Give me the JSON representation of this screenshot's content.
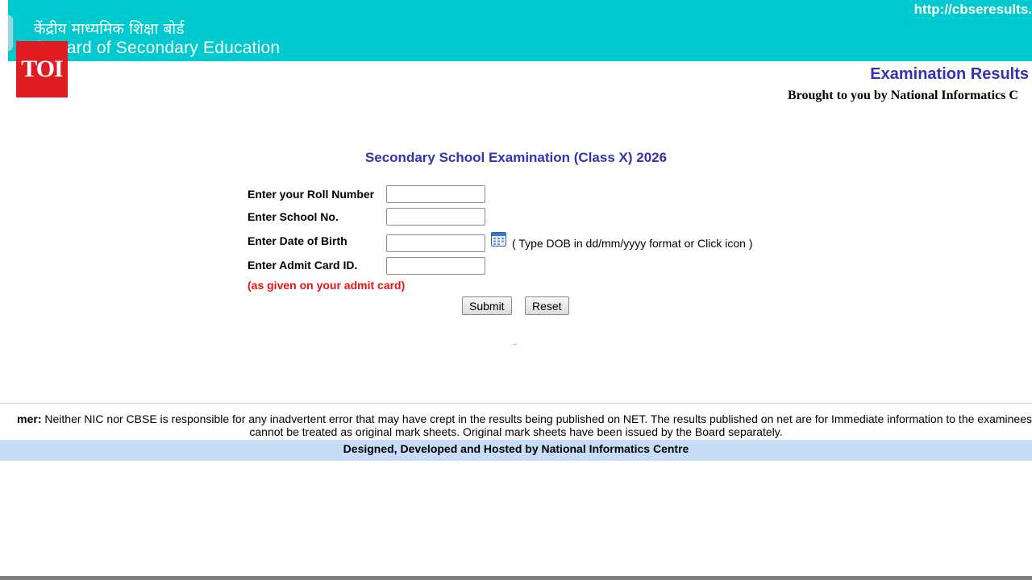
{
  "header": {
    "hindi_title": "केंद्रीय माध्यमिक शिक्षा बोर्ड",
    "english_title": "al Board of Secondary Education",
    "url": "http://cbseresults.",
    "toi_logo": "TOI"
  },
  "subheader": {
    "exam_results": "Examination Results",
    "brought_by": "Brought to you by National Informatics C"
  },
  "form": {
    "heading": "Secondary School Examination (Class X) 2026",
    "roll_label": "Enter your Roll Number",
    "roll_value": "",
    "school_label": "Enter School No.",
    "school_value": "",
    "dob_label": "Enter Date of Birth",
    "dob_value": "",
    "dob_hint": "( Type DOB in dd/mm/yyyy format or Click icon )",
    "admit_label": "Enter Admit Card ID.",
    "admit_value": "",
    "admit_note": "(as given on your admit card)",
    "submit_label": "Submit",
    "reset_label": "Reset",
    "calendar_icon": "calendar-icon"
  },
  "footer": {
    "disclaimer_prefix": "mer:",
    "disclaimer_line1": " Neither NIC nor CBSE is responsible for any inadvertent error that may have crept in the results being published on NET. The results published on net are for Immediate information to the examinees",
    "disclaimer_line2": "cannot be treated as original mark sheets. Original mark sheets have been issued by the Board separately.",
    "credit": "Designed, Developed and Hosted by National Informatics Centre"
  },
  "colors": {
    "banner": "#00c9cf",
    "heading_blue": "#3333b3",
    "note_red": "#ee1111",
    "footer_bar": "#c6dcf7",
    "toi_red": "#e11b22"
  }
}
